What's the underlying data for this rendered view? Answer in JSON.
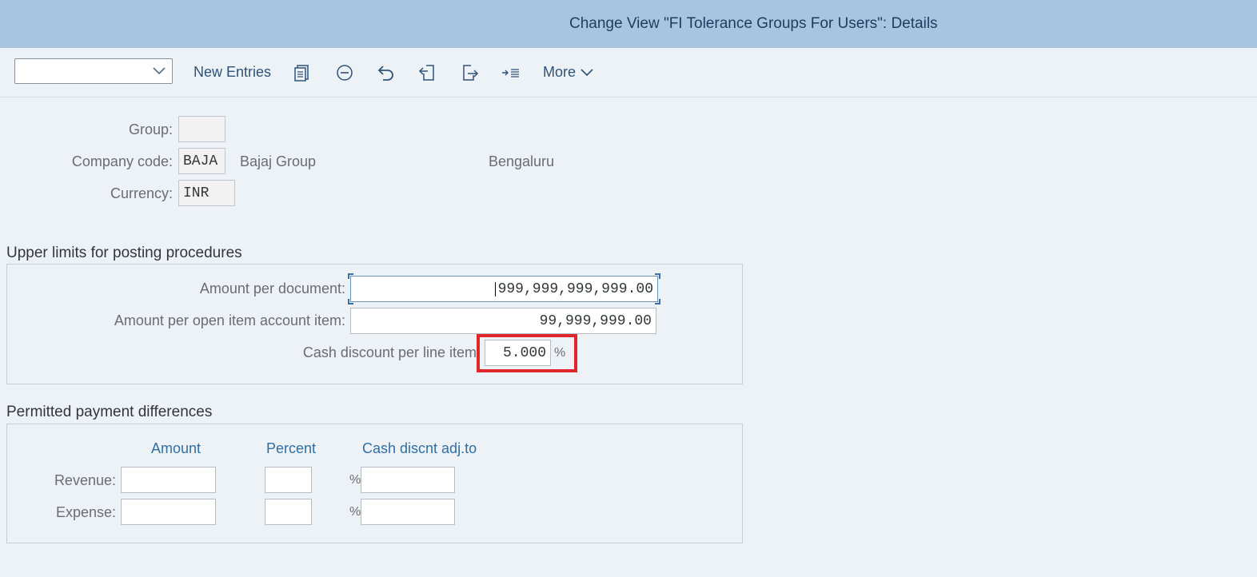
{
  "header": {
    "title": "Change View \"FI Tolerance Groups For Users\": Details"
  },
  "toolbar": {
    "dropdown_value": "",
    "new_entries": "New Entries",
    "more": "More",
    "icons": [
      "copy-icon",
      "delete-icon",
      "undo-icon",
      "previous-entry-icon",
      "next-entry-icon",
      "select-block-icon"
    ]
  },
  "details": {
    "group_label": "Group:",
    "group_value": "",
    "company_code_label": "Company code:",
    "company_code_value": "BAJA",
    "company_name": "Bajaj Group",
    "company_city": "Bengaluru",
    "currency_label": "Currency:",
    "currency_value": "INR"
  },
  "upper_limits": {
    "title": "Upper limits for posting procedures",
    "amount_per_document_label": "Amount per document:",
    "amount_per_document_value": "999,999,999,999.00",
    "amount_per_open_item_label": "Amount per open item account item:",
    "amount_per_open_item_value": "99,999,999.00",
    "cash_discount_label": "Cash discount per line item",
    "cash_discount_value": "5.000",
    "cash_discount_unit": "%"
  },
  "payment_differences": {
    "title": "Permitted payment differences",
    "columns": [
      "Amount",
      "Percent",
      "Cash discnt adj.to"
    ],
    "rows": [
      {
        "label": "Revenue:",
        "amount": "",
        "percent": "",
        "unit": "%",
        "cash_discount_adj": ""
      },
      {
        "label": "Expense:",
        "amount": "",
        "percent": "",
        "unit": "%",
        "cash_discount_adj": ""
      }
    ]
  },
  "colors": {
    "title_bar": "#a9c4de",
    "background": "#edf2f7",
    "highlight": "#e0262c",
    "column_header": "#2f6fa6"
  }
}
